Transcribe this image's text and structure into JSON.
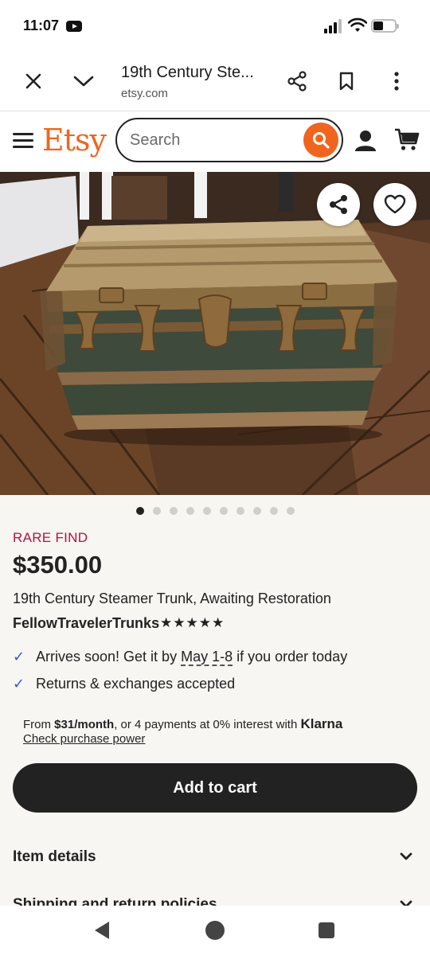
{
  "status_bar": {
    "time": "11:07"
  },
  "browser": {
    "page_title": "19th Century Ste...",
    "url": "etsy.com"
  },
  "etsy_header": {
    "logo": "Etsy",
    "search_placeholder": "Search"
  },
  "gallery": {
    "image_count": 10,
    "active_index": 0
  },
  "product": {
    "badge": "RARE FIND",
    "price": "$350.00",
    "title": "19th Century Steamer Trunk, Awaiting Restoration",
    "shop": "FellowTravelerTrunks",
    "rating_stars": "★★★★★",
    "rating": 5
  },
  "delivery": {
    "arrives_prefix": "Arrives soon! Get it by ",
    "arrives_date": "May 1-8",
    "arrives_suffix": " if you order today",
    "returns": "Returns & exchanges accepted"
  },
  "klarna": {
    "from": "From ",
    "amount": "$31/month",
    "middle": ", or 4 payments at 0% interest with ",
    "brand": "Klarna",
    "link": "Check purchase power"
  },
  "cart": {
    "button_label": "Add to cart"
  },
  "sections": [
    {
      "label": "Item details"
    },
    {
      "label": "Shipping and return policies"
    }
  ],
  "colors": {
    "brand": "#f1641e",
    "badge": "#b3123f",
    "check": "#2f5bd6",
    "button": "#222222"
  }
}
